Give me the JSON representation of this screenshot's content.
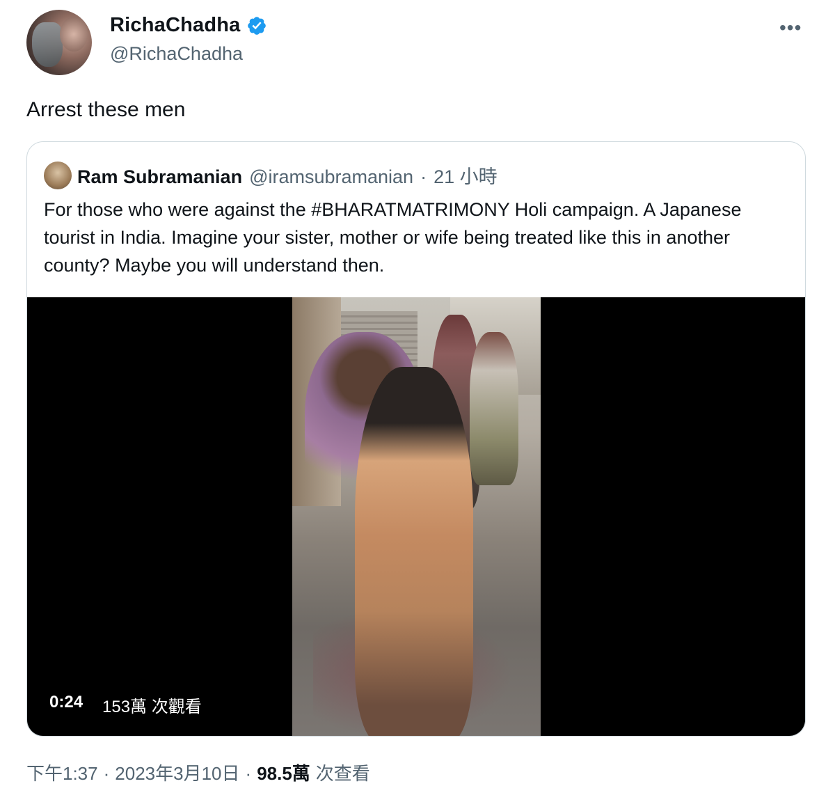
{
  "author": {
    "display_name": "RichaChadha",
    "handle": "@RichaChadha",
    "verified_icon": "verified-badge-icon",
    "more_label": "•••"
  },
  "tweet": {
    "text": "Arrest these men"
  },
  "quote": {
    "author_name": "Ram Subramanian",
    "author_handle": "@iramsubramanian",
    "separator": "·",
    "time": "21 小時",
    "text": "For those who were against the #BHARATMATRIMONY Holi campaign.  A Japanese tourist in India. Imagine your sister, mother or wife being treated like this in another county? Maybe you will understand then.",
    "video": {
      "duration": "0:24",
      "views": "153萬 次觀看"
    }
  },
  "footer": {
    "time": "下午1:37",
    "date": "2023年3月10日",
    "separator": "·",
    "views_count": "98.5萬",
    "views_label": "次查看"
  },
  "colors": {
    "verified": "#1d9bf0",
    "secondary_text": "#536471",
    "border": "#cfd9de"
  }
}
